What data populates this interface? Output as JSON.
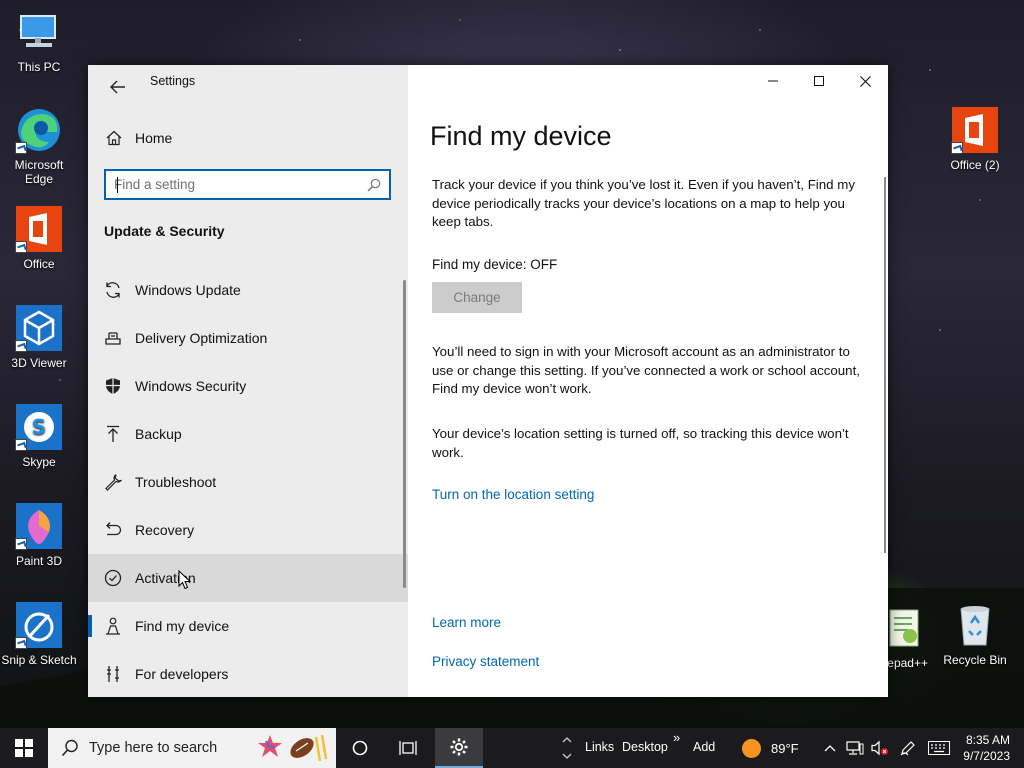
{
  "desktop": {
    "left_icons": [
      {
        "label": "This PC"
      },
      {
        "label": "Microsoft\nEdge"
      },
      {
        "label": "Office"
      },
      {
        "label": "3D Viewer"
      },
      {
        "label": "Skype"
      },
      {
        "label": "Paint 3D"
      },
      {
        "label": "Snip & Sketch"
      }
    ],
    "right_icons": [
      {
        "label": "Office (2)"
      },
      {
        "label": "epad++"
      },
      {
        "label": "Recycle Bin"
      }
    ]
  },
  "window": {
    "app_title": "Settings",
    "home_label": "Home",
    "search_placeholder": "Find a setting",
    "section_title": "Update & Security",
    "nav_items": [
      {
        "label": "Windows Update",
        "icon": "refresh-icon"
      },
      {
        "label": "Delivery Optimization",
        "icon": "delivery-icon"
      },
      {
        "label": "Windows Security",
        "icon": "shield-icon"
      },
      {
        "label": "Backup",
        "icon": "backup-icon"
      },
      {
        "label": "Troubleshoot",
        "icon": "wrench-icon"
      },
      {
        "label": "Recovery",
        "icon": "recovery-icon"
      },
      {
        "label": "Activation",
        "icon": "check-circle-icon"
      },
      {
        "label": "Find my device",
        "icon": "person-location-icon"
      },
      {
        "label": "For developers",
        "icon": "developer-icon"
      }
    ],
    "hovered_item": "Activation",
    "active_item": "Find my device"
  },
  "content": {
    "title": "Find my device",
    "intro": "Track your device if you think you’ve lost it. Even if you haven’t, Find my device periodically tracks your device’s locations on a map to help you keep tabs.",
    "status": "Find my device: OFF",
    "change_button": "Change",
    "admin_note": "You’ll need to sign in with your Microsoft account as an administrator to use or change this setting. If you’ve connected a work or school account, Find my device won’t work.",
    "location_note": "Your device’s location setting is turned off, so tracking this device won’t work.",
    "location_link": "Turn on the location setting",
    "learn_more": "Learn more",
    "privacy": "Privacy statement"
  },
  "taskbar": {
    "search_placeholder": "Type here to search",
    "links": "Links",
    "desktop": "Desktop",
    "chevron": "»",
    "add": "Add",
    "weather": "89°F",
    "time": "8:35 AM",
    "date": "9/7/2023"
  },
  "colors": {
    "accent": "#0063b1",
    "link": "#0067b8"
  }
}
